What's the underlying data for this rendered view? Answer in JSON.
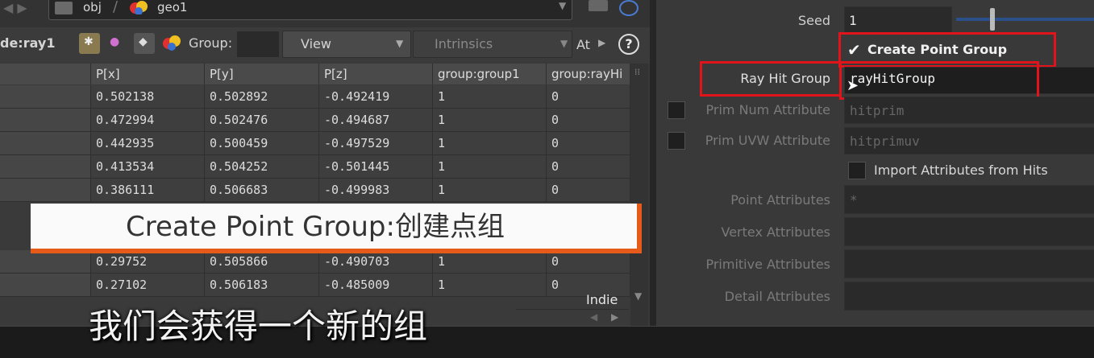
{
  "path": {
    "obj": "obj",
    "geo": "geo1"
  },
  "toolbar": {
    "node_label": "de:ray1",
    "group_label": "Group:",
    "view_label": "View",
    "intrinsics_label": "Intrinsics",
    "at_label": "At",
    "help": "?"
  },
  "table": {
    "columns": [
      "P[x]",
      "P[y]",
      "P[z]",
      "group:group1",
      "group:rayHi"
    ],
    "rows": [
      [
        "0.502138",
        "0.502892",
        "-0.492419",
        "1",
        "0"
      ],
      [
        "0.472994",
        "0.502476",
        "-0.494687",
        "1",
        "0"
      ],
      [
        "0.442935",
        "0.500459",
        "-0.497529",
        "1",
        "0"
      ],
      [
        "0.413534",
        "0.504252",
        "-0.501445",
        "1",
        "0"
      ],
      [
        "0.386111",
        "0.506683",
        "-0.499983",
        "1",
        "0"
      ],
      [
        "0.29752",
        "0.505866",
        "-0.490703",
        "1",
        "0"
      ],
      [
        "0.27102",
        "0.506183",
        "-0.485009",
        "1",
        "0"
      ]
    ],
    "watermark": "Indie"
  },
  "params": {
    "seed_label": "Seed",
    "seed_value": "1",
    "create_point_group_label": "Create Point Group",
    "ray_hit_group_label": "Ray Hit Group",
    "ray_hit_group_value": "rayHitGroup",
    "prim_num_label": "Prim Num Attribute",
    "prim_num_value": "hitprim",
    "prim_uvw_label": "Prim UVW Attribute",
    "prim_uvw_value": "hitprimuv",
    "import_attrs_label": "Import Attributes from Hits",
    "point_attrs_label": "Point Attributes",
    "point_attrs_value": "*",
    "vertex_attrs_label": "Vertex Attributes",
    "primitive_attrs_label": "Primitive Attributes",
    "detail_attrs_label": "Detail Attributes"
  },
  "overlay": {
    "banner_text": "Create Point Group:创建点组",
    "subtitle": "我们会获得一个新的组"
  },
  "colors": {
    "highlight_red": "#e0141a",
    "banner_accent": "#e65a1a"
  }
}
